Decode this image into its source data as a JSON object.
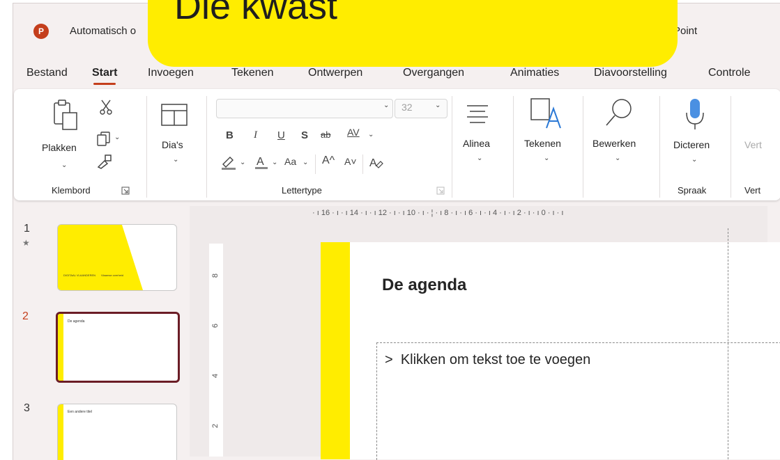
{
  "app": {
    "logo_letter": "P",
    "title_left": "Automatisch o",
    "title_right": "Point"
  },
  "overlay": {
    "text": "Die kwast",
    "color": "#ffed00"
  },
  "tabs": [
    {
      "label": "Bestand"
    },
    {
      "label": "Start",
      "active": true
    },
    {
      "label": "Invoegen"
    },
    {
      "label": "Tekenen"
    },
    {
      "label": "Ontwerpen"
    },
    {
      "label": "Overgangen"
    },
    {
      "label": "Animaties"
    },
    {
      "label": "Diavoorstelling"
    },
    {
      "label": "Controle"
    }
  ],
  "ribbon": {
    "clipboard": {
      "paste": "Plakken",
      "group": "Klembord"
    },
    "slides": {
      "label": "Dia's"
    },
    "font": {
      "size": "32",
      "bold": "B",
      "italic": "I",
      "underline": "U",
      "shadow": "S",
      "strike": "ab",
      "spacing": "AV",
      "case": "Aa",
      "grow": "A^",
      "shrink": "A˅",
      "group": "Lettertype"
    },
    "paragraph": {
      "label": "Alinea"
    },
    "drawing": {
      "label": "Tekenen"
    },
    "editing": {
      "label": "Bewerken"
    },
    "dictate": {
      "label": "Dicteren",
      "group": "Spraak"
    },
    "cut_off": {
      "label": "Vert",
      "group": "Vert"
    }
  },
  "ruler": {
    "h_ticks": "· ı 16 · ı · ı 14 · ı · ı 12 · ı · ı 10 · ı · ¦ · ı 8 · ı · ı 6 · ı · ı 4 · ı · ı 2 · ı · ı 0 · ı · ı",
    "v_labels": [
      "8",
      "6",
      "4",
      "2"
    ]
  },
  "thumbnails": [
    {
      "number": "1",
      "marker": "★",
      "footer_left": "DIGITAAL VLAANDEREN",
      "footer_right": "Vlaamse overheid"
    },
    {
      "number": "2",
      "text": "De agenda",
      "selected": true
    },
    {
      "number": "3",
      "text": "Een andere titel"
    }
  ],
  "slide": {
    "title": "De agenda",
    "bullet": ">",
    "placeholder": "Klikken om tekst toe te voegen"
  },
  "colors": {
    "accent": "#c43e1c",
    "yellow": "#ffed00",
    "selected_border": "#6b1d26"
  }
}
